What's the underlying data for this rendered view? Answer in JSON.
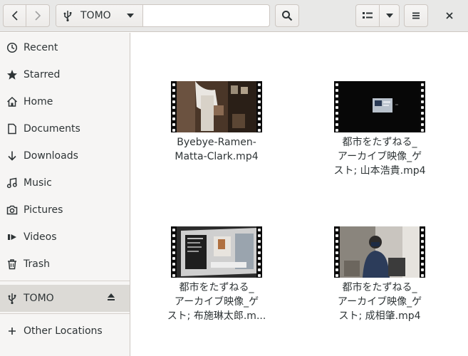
{
  "header": {
    "location": "TOMO",
    "search_placeholder": ""
  },
  "sidebar": {
    "items": [
      {
        "label": "Recent",
        "icon": "clock-icon"
      },
      {
        "label": "Starred",
        "icon": "star-icon"
      },
      {
        "label": "Home",
        "icon": "home-icon"
      },
      {
        "label": "Documents",
        "icon": "document-icon"
      },
      {
        "label": "Downloads",
        "icon": "download-icon"
      },
      {
        "label": "Music",
        "icon": "music-icon"
      },
      {
        "label": "Pictures",
        "icon": "camera-icon"
      },
      {
        "label": "Videos",
        "icon": "video-icon"
      },
      {
        "label": "Trash",
        "icon": "trash-icon"
      }
    ],
    "device": {
      "label": "TOMO",
      "icon": "usb-icon"
    },
    "other": {
      "label": "Other Locations",
      "icon": "plus-icon"
    }
  },
  "files": [
    {
      "lines": [
        "Byebye-Ramen-",
        "Matta-Clark.mp4"
      ]
    },
    {
      "lines": [
        "都市をたずねる_",
        "アーカイブ映像_ゲ",
        "スト; 山本浩貴.mp4"
      ]
    },
    {
      "lines": [
        "都市をたずねる_",
        "アーカイブ映像_ゲ",
        "スト; 布施琳太郎.m..."
      ]
    },
    {
      "lines": [
        "都市をたずねる_",
        "アーカイブ映像_ゲ",
        "スト; 成相肇.mp4"
      ]
    }
  ]
}
